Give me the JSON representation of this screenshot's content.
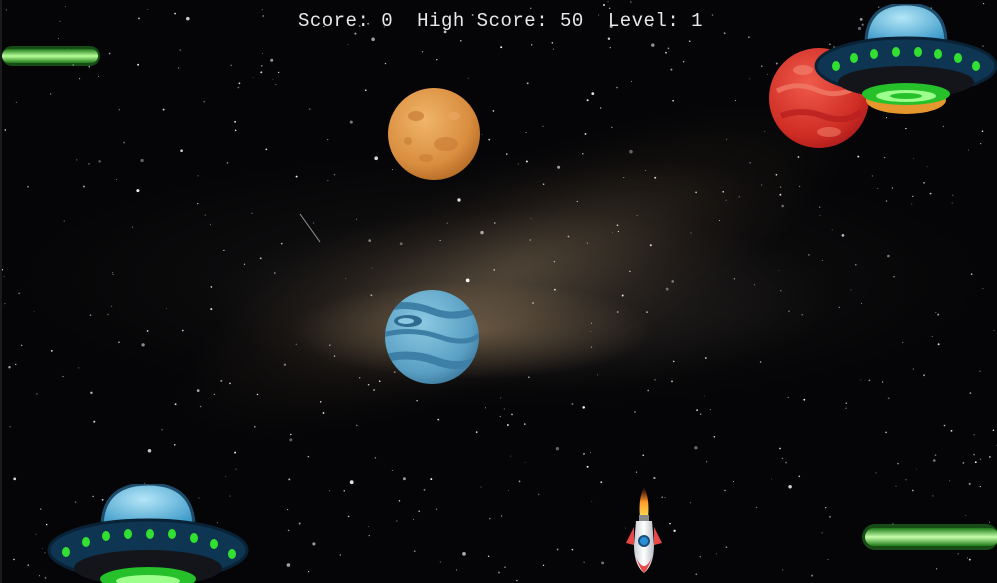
{
  "hud": {
    "score_label": "Score:",
    "score_value": "0",
    "high_score_label": "High Score:",
    "high_score_value": "50",
    "level_label": "Level:",
    "level_value": "1"
  },
  "entities": {
    "player": "rocket-icon",
    "enemies": [
      "ufo-icon",
      "ufo-icon"
    ],
    "planets": [
      "orange-planet-icon",
      "red-planet-icon",
      "blue-planet-icon"
    ],
    "projectiles": [
      "green-laser-icon",
      "green-laser-icon"
    ]
  },
  "colors": {
    "hud_text": "#e8e8e8",
    "laser": "#39d630",
    "ufo_body": "#0e3552",
    "ufo_dome": "#5fb8e0"
  }
}
